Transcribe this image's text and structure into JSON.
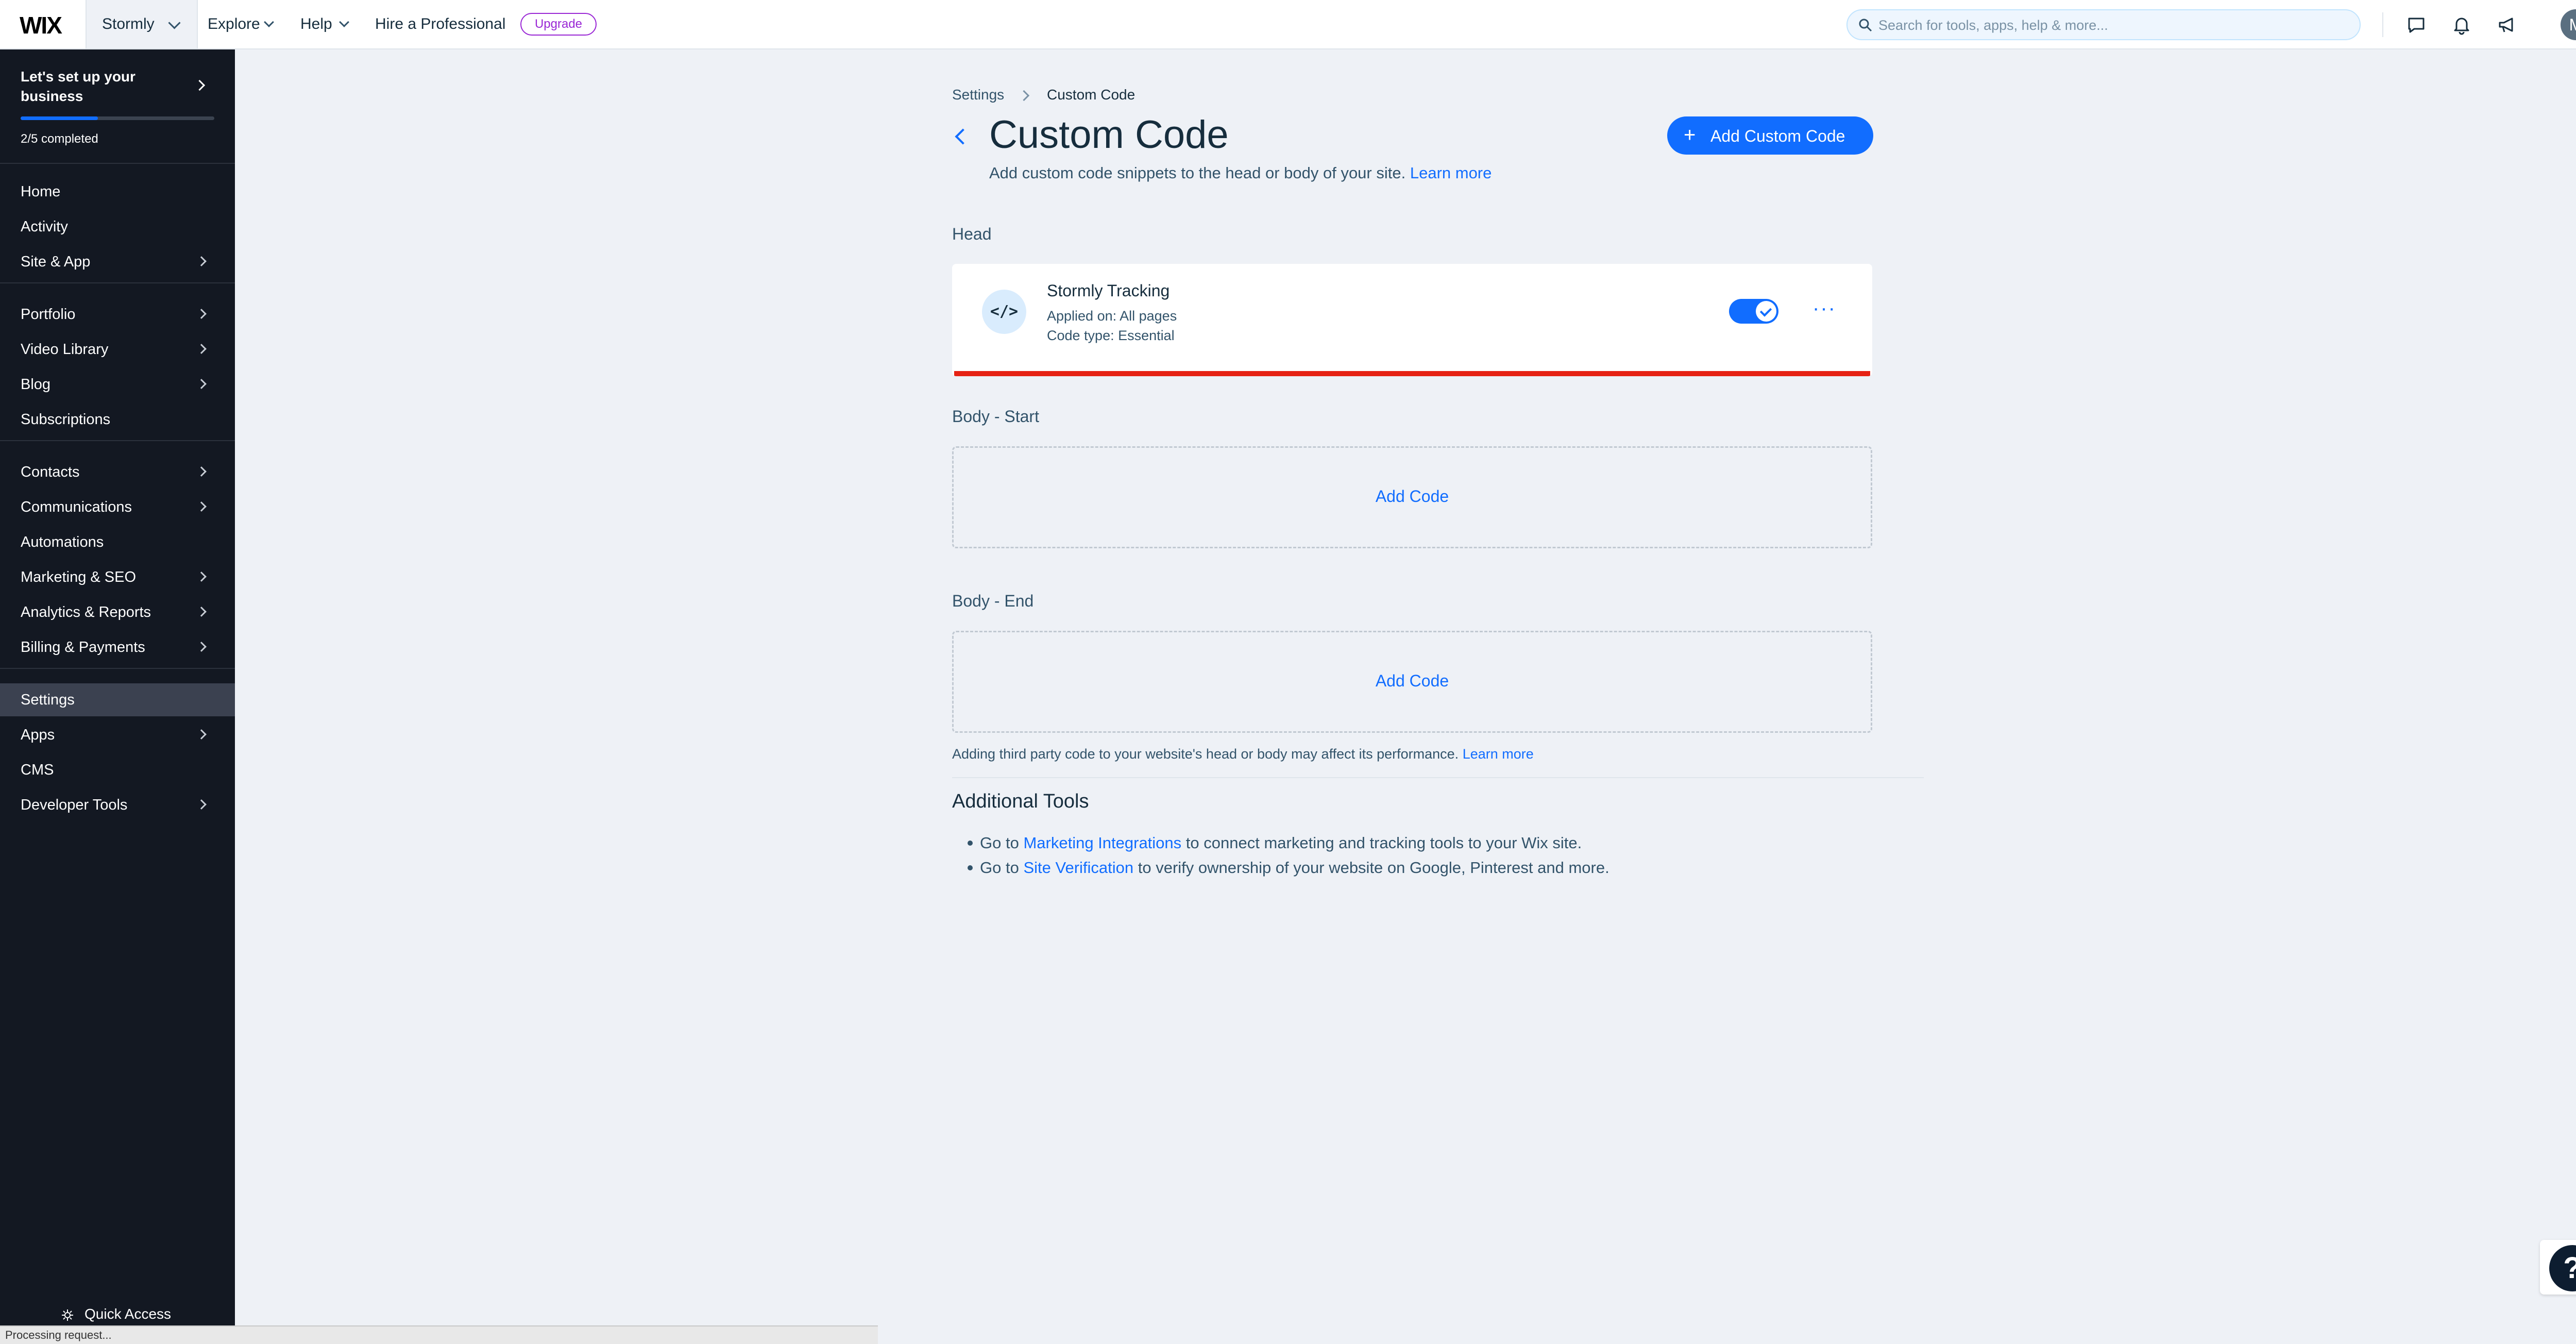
{
  "topbar": {
    "logo": "WIX",
    "site_name": "Stormly",
    "explore": "Explore",
    "help": "Help",
    "hire": "Hire a Professional",
    "upgrade": "Upgrade",
    "search_placeholder": "Search for tools, apps, help & more...",
    "avatar_initial": "M",
    "icons": [
      "chat-icon",
      "bell-icon",
      "megaphone-icon"
    ]
  },
  "sidebar": {
    "setup": {
      "title": "Let's set up your business",
      "progress_text": "2/5 completed",
      "progress_fraction": 0.4
    },
    "items": [
      {
        "label": "Home",
        "arrow": false
      },
      {
        "label": "Activity",
        "arrow": false
      },
      {
        "label": "Site & App",
        "arrow": true
      },
      {
        "label": "Portfolio",
        "arrow": true
      },
      {
        "label": "Video Library",
        "arrow": true
      },
      {
        "label": "Blog",
        "arrow": true
      },
      {
        "label": "Subscriptions",
        "arrow": false
      },
      {
        "label": "Contacts",
        "arrow": true
      },
      {
        "label": "Communications",
        "arrow": true
      },
      {
        "label": "Automations",
        "arrow": false
      },
      {
        "label": "Marketing & SEO",
        "arrow": true
      },
      {
        "label": "Analytics & Reports",
        "arrow": true
      },
      {
        "label": "Billing & Payments",
        "arrow": true
      },
      {
        "label": "Settings",
        "arrow": false,
        "active": true
      },
      {
        "label": "Apps",
        "arrow": true
      },
      {
        "label": "CMS",
        "arrow": false
      },
      {
        "label": "Developer Tools",
        "arrow": true
      }
    ],
    "quick_access": "Quick Access",
    "status": "Processing request..."
  },
  "main": {
    "breadcrumb": {
      "parent": "Settings",
      "current": "Custom Code"
    },
    "title": "Custom Code",
    "subtitle": "Add custom code snippets to the head or body of your site.",
    "subtitle_link": "Learn more",
    "add_button": "Add Custom Code",
    "head_label": "Head",
    "snippet": {
      "icon_glyph": "</>",
      "name": "Stormly Tracking",
      "applied_on": "Applied on: All pages",
      "code_type": "Code type: Essential",
      "enabled": true,
      "more": "···"
    },
    "body_start_label": "Body - Start",
    "body_start_add": "Add Code",
    "body_end_label": "Body - End",
    "body_end_add": "Add Code",
    "note": "Adding third party code to your website's head or body may affect its performance.",
    "note_link": "Learn more",
    "tools": {
      "title": "Additional Tools",
      "line1_pre": "Go to",
      "line1_link": "Marketing Integrations",
      "line1_post": "to connect marketing and tracking tools to your Wix site.",
      "line2_pre": "Go to",
      "line2_link": "Site Verification",
      "line2_post": "to verify ownership of your website on Google, Pinterest and more."
    },
    "help_glyph": "?"
  },
  "colors": {
    "accent": "#116dff",
    "sidebar_bg": "#131822",
    "error_bar": "#e62214",
    "upgrade": "#9a27d5"
  }
}
